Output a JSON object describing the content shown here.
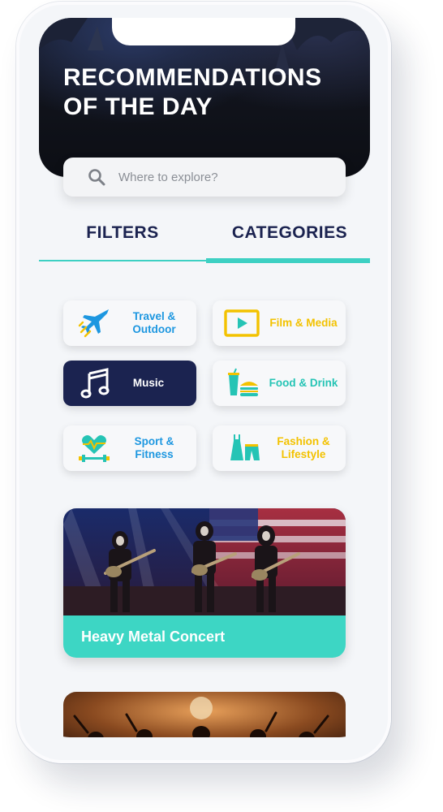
{
  "header": {
    "title_line1": "RECOMMENDATIONS",
    "title_line2": "OF THE DAY"
  },
  "search": {
    "placeholder": "Where to explore?",
    "icon": "search-icon"
  },
  "tabs": [
    {
      "label": "FILTERS",
      "active": false
    },
    {
      "label": "CATEGORIES",
      "active": true
    }
  ],
  "categories": [
    {
      "line1": "Travel &",
      "line2": "Outdoor",
      "icon": "airplane-icon",
      "color": "#1d97e0"
    },
    {
      "line1": "Film & Media",
      "line2": "",
      "icon": "play-screen-icon",
      "color": "#f3c200"
    },
    {
      "line1": "Music",
      "line2": "",
      "icon": "music-note-icon",
      "color": "#ffffff",
      "selected": true
    },
    {
      "line1": "Food & Drink",
      "line2": "",
      "icon": "burger-drink-icon",
      "color": "#25c4b5"
    },
    {
      "line1": "Sport &",
      "line2": "Fitness",
      "icon": "heart-dumbbell-icon",
      "color": "#1d97e0"
    },
    {
      "line1": "Fashion &",
      "line2": "Lifestyle",
      "icon": "dress-pants-icon",
      "color": "#f3c200"
    }
  ],
  "events": [
    {
      "title": "Heavy Metal Concert"
    }
  ],
  "colors": {
    "accent": "#3dd0c3",
    "navy": "#1b2350",
    "yellow": "#f3c200",
    "blue": "#1d97e0"
  }
}
